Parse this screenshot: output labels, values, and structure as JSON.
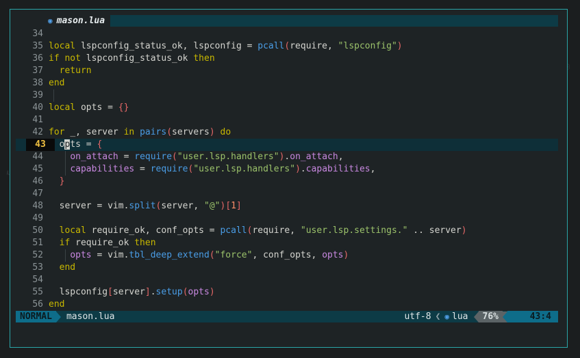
{
  "tabline": {
    "filename": "mason.lua",
    "icon": "lua-file-icon"
  },
  "editor": {
    "lines": [
      {
        "n": "34",
        "segs": []
      },
      {
        "n": "35",
        "segs": [
          [
            "k",
            "local "
          ],
          [
            "p",
            "lspconfig_status_ok, lspconfig = "
          ],
          [
            "f",
            "pcall"
          ],
          [
            "br",
            "("
          ],
          [
            "p",
            "require, "
          ],
          [
            "s",
            "\"lspconfig\""
          ],
          [
            "br",
            ")"
          ]
        ]
      },
      {
        "n": "36",
        "segs": [
          [
            "k",
            "if not "
          ],
          [
            "p",
            "lspconfig_status_ok "
          ],
          [
            "k",
            "then"
          ]
        ]
      },
      {
        "n": "37",
        "segs": [
          [
            "p",
            "  "
          ],
          [
            "k",
            "return"
          ]
        ]
      },
      {
        "n": "38",
        "segs": [
          [
            "k",
            "end"
          ]
        ]
      },
      {
        "n": "39",
        "segs": []
      },
      {
        "n": "40",
        "segs": [
          [
            "k",
            "local "
          ],
          [
            "p",
            "opts = "
          ],
          [
            "br",
            "{}"
          ]
        ]
      },
      {
        "n": "41",
        "segs": []
      },
      {
        "n": "42",
        "segs": [
          [
            "k",
            "for "
          ],
          [
            "p",
            "_, server "
          ],
          [
            "k",
            "in "
          ],
          [
            "f",
            "pairs"
          ],
          [
            "br",
            "("
          ],
          [
            "p",
            "servers"
          ],
          [
            "br",
            ")"
          ],
          [
            "k",
            " do"
          ]
        ]
      },
      {
        "n": "43",
        "cur": true,
        "segs": [
          [
            "p",
            "  o"
          ],
          [
            "cursor",
            "p"
          ],
          [
            "p",
            "ts = "
          ],
          [
            "br",
            "{"
          ]
        ]
      },
      {
        "n": "44",
        "segs": [
          [
            "p",
            "    "
          ],
          [
            "n",
            "on_attach"
          ],
          [
            "p",
            " = "
          ],
          [
            "f",
            "require"
          ],
          [
            "br",
            "("
          ],
          [
            "s",
            "\"user.lsp.handlers\""
          ],
          [
            "br",
            ")"
          ],
          [
            "p",
            "."
          ],
          [
            "n",
            "on_attach"
          ],
          [
            "p",
            ","
          ]
        ]
      },
      {
        "n": "45",
        "segs": [
          [
            "p",
            "    "
          ],
          [
            "n",
            "capabilities"
          ],
          [
            "p",
            " = "
          ],
          [
            "f",
            "require"
          ],
          [
            "br",
            "("
          ],
          [
            "s",
            "\"user.lsp.handlers\""
          ],
          [
            "br",
            ")"
          ],
          [
            "p",
            "."
          ],
          [
            "n",
            "capabilities"
          ],
          [
            "p",
            ","
          ]
        ]
      },
      {
        "n": "46",
        "segs": [
          [
            "p",
            "  "
          ],
          [
            "br",
            "}"
          ]
        ]
      },
      {
        "n": "47",
        "segs": []
      },
      {
        "n": "48",
        "segs": [
          [
            "p",
            "  server = vim."
          ],
          [
            "f",
            "split"
          ],
          [
            "br",
            "("
          ],
          [
            "p",
            "server, "
          ],
          [
            "s",
            "\"@\""
          ],
          [
            "br",
            ")"
          ],
          [
            "br",
            "["
          ],
          [
            "num",
            "1"
          ],
          [
            "br",
            "]"
          ]
        ]
      },
      {
        "n": "49",
        "segs": []
      },
      {
        "n": "50",
        "segs": [
          [
            "p",
            "  "
          ],
          [
            "k",
            "local "
          ],
          [
            "p",
            "require_ok, conf_opts = "
          ],
          [
            "f",
            "pcall"
          ],
          [
            "br",
            "("
          ],
          [
            "p",
            "require, "
          ],
          [
            "s",
            "\"user.lsp.settings.\""
          ],
          [
            "p",
            " .. server"
          ],
          [
            "br",
            ")"
          ]
        ]
      },
      {
        "n": "51",
        "segs": [
          [
            "p",
            "  "
          ],
          [
            "k",
            "if "
          ],
          [
            "p",
            "require_ok "
          ],
          [
            "k",
            "then"
          ]
        ]
      },
      {
        "n": "52",
        "segs": [
          [
            "p",
            "    "
          ],
          [
            "n",
            "opts"
          ],
          [
            "p",
            " = vim."
          ],
          [
            "f",
            "tbl_deep_extend"
          ],
          [
            "br",
            "("
          ],
          [
            "s",
            "\"force\""
          ],
          [
            "p",
            ", conf_opts, "
          ],
          [
            "n",
            "opts"
          ],
          [
            "br",
            ")"
          ]
        ]
      },
      {
        "n": "53",
        "segs": [
          [
            "p",
            "  "
          ],
          [
            "k",
            "end"
          ]
        ]
      },
      {
        "n": "54",
        "segs": []
      },
      {
        "n": "55",
        "segs": [
          [
            "p",
            "  lspconfig"
          ],
          [
            "br",
            "["
          ],
          [
            "p",
            "server"
          ],
          [
            "br",
            "]"
          ],
          [
            "p",
            "."
          ],
          [
            "f",
            "setup"
          ],
          [
            "br",
            "("
          ],
          [
            "n",
            "opts"
          ],
          [
            "br",
            ")"
          ]
        ]
      },
      {
        "n": "56",
        "segs": [
          [
            "k",
            "end"
          ]
        ]
      }
    ]
  },
  "statusline": {
    "mode": "NORMAL",
    "filename": "mason.lua",
    "encoding": "utf-8",
    "separator": "❮",
    "filetype": "lua",
    "percent": "76%",
    "position": "43:4"
  },
  "colors": {
    "accent": "#0e6d8a",
    "frame": "#2aa6a8",
    "bar": "#0d3b46"
  }
}
